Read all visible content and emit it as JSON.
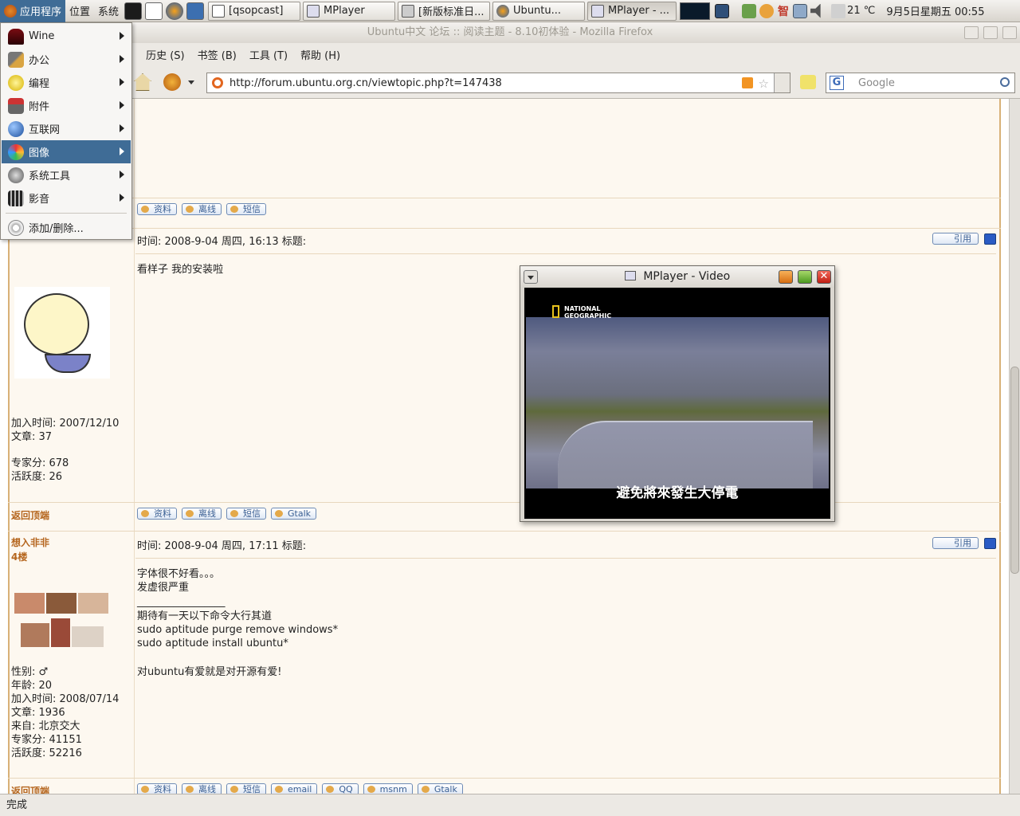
{
  "panel": {
    "menus": [
      "应用程序",
      "位置",
      "系统"
    ],
    "tasks": [
      "[qsopcast]",
      "MPlayer",
      "[新版标准日...",
      "Ubuntu...",
      "MPlayer - ..."
    ],
    "temperature": "21 ℃",
    "datetime": "9月5日星期五 00:55",
    "tray_text": "智"
  },
  "app_menu": {
    "items": [
      {
        "label": "Wine",
        "icon": "wine-icon"
      },
      {
        "label": "办公",
        "icon": "office-icon"
      },
      {
        "label": "编程",
        "icon": "programming-icon"
      },
      {
        "label": "附件",
        "icon": "accessories-icon"
      },
      {
        "label": "互联网",
        "icon": "internet-icon"
      },
      {
        "label": "图像",
        "icon": "graphics-icon"
      },
      {
        "label": "系统工具",
        "icon": "system-tools-icon"
      },
      {
        "label": "影音",
        "icon": "multimedia-icon"
      }
    ],
    "add_remove": "添加/删除..."
  },
  "firefox": {
    "title": "Ubuntu中文 论坛 :: 阅读主题 - 8.10初体验 - Mozilla Firefox",
    "menubar": [
      ")",
      "历史 (S)",
      "书签 (B)",
      "工具 (T)",
      "帮助 (H)"
    ],
    "url": "http://forum.ubuntu.org.cn/viewtopic.php?t=147438",
    "search_placeholder": "Google",
    "status": "完成"
  },
  "forum": {
    "post1_buttons": [
      "资料",
      "离线",
      "短信"
    ],
    "post2": {
      "header": "时间: 2008-9-04 周四, 16:13    标题:",
      "quote_label": "引用",
      "body": "看样子 我的安装啦",
      "userinfo": [
        "加入时间: 2007/12/10",
        "文章: 37",
        "",
        "专家分: 678",
        "活跃度: 26"
      ],
      "back_to_top": "返回顶端",
      "buttons": [
        "资料",
        "离线",
        "短信",
        "Gtalk"
      ]
    },
    "post3": {
      "username": "想入非非",
      "floor": "4楼",
      "header": "时间: 2008-9-04 周四, 17:11    标题:",
      "quote_label": "引用",
      "body": [
        "字体很不好看。。。",
        "发虚很严重",
        "_________________",
        "期待有一天以下命令大行其道",
        "sudo aptitude purge remove windows*",
        "sudo aptitude install ubuntu*",
        "",
        "对ubuntu有爱就是对开源有爱!"
      ],
      "userinfo": [
        "性别: ♂",
        "年龄: 20",
        "加入时间: 2008/07/14",
        "文章: 1936",
        "来自: 北京交大",
        "专家分: 41151",
        "活跃度: 52216"
      ],
      "back_to_top": "返回顶端",
      "buttons": [
        "资料",
        "离线",
        "短信",
        "email",
        "QQ",
        "msnm",
        "Gtalk"
      ]
    }
  },
  "mplayer": {
    "title": "MPlayer - Video",
    "logo_lines": [
      "NATIONAL",
      "GEOGRAPHIC"
    ],
    "subtitle": "避免將來發生大停電"
  },
  "colors": {
    "accent": "#3f6c96",
    "forum_border": "#d8b178",
    "link": "#b5651d"
  }
}
